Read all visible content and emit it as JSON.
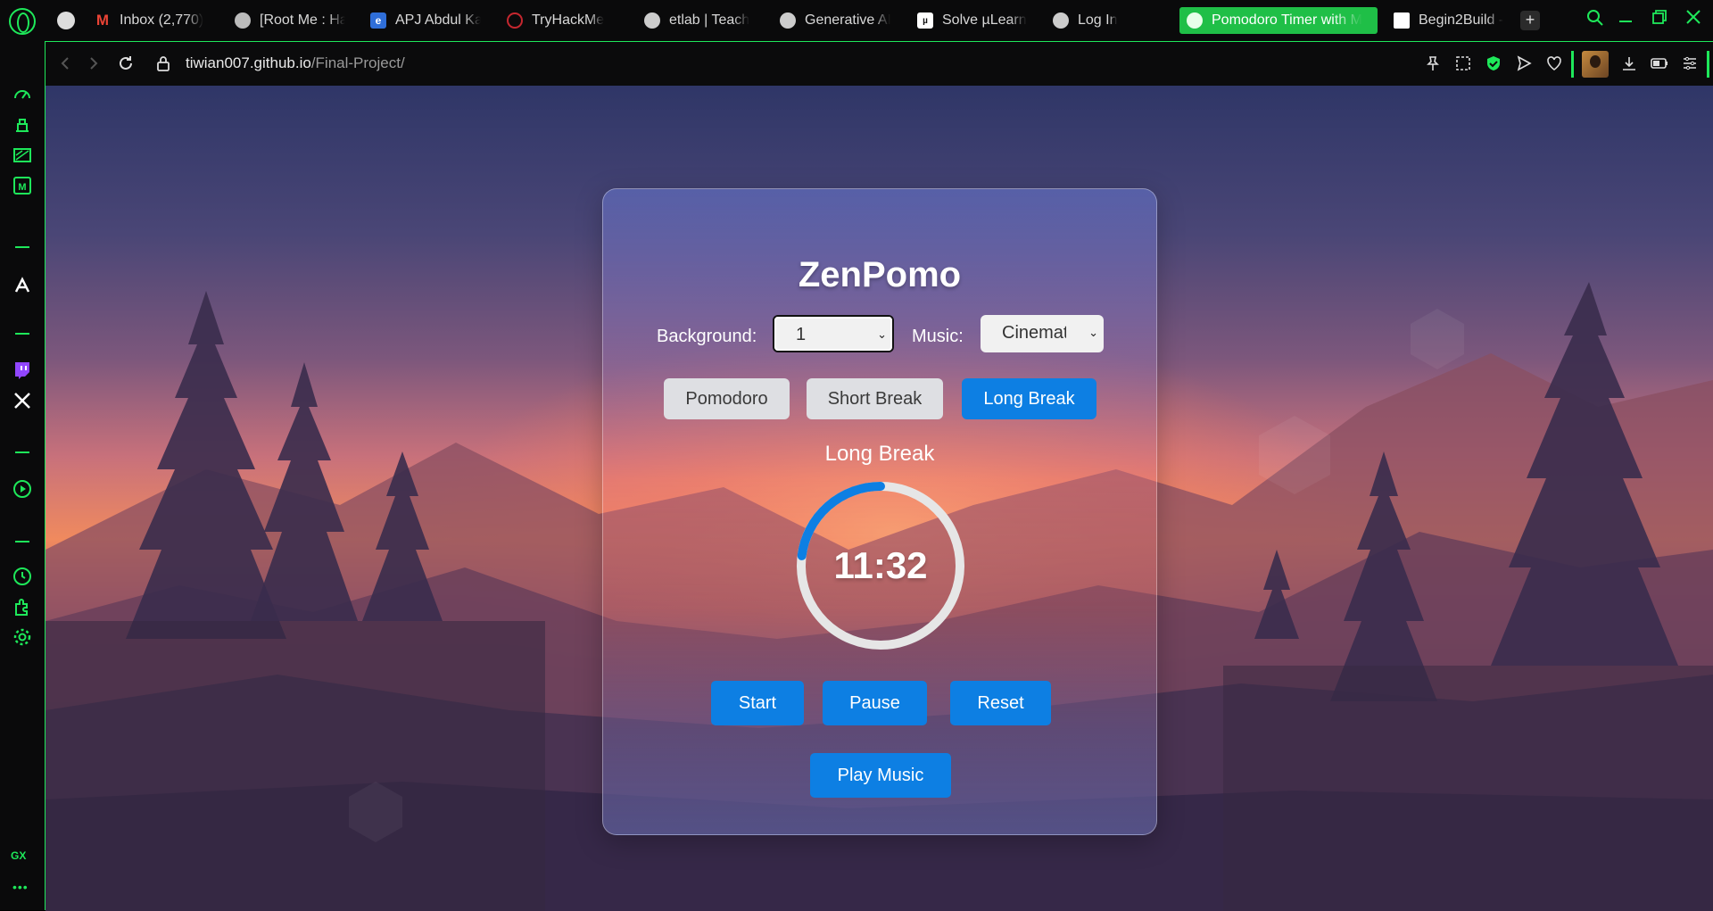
{
  "tabs": [
    {
      "label": "Inbox (2,770)",
      "icon": "gmail-icon"
    },
    {
      "label": "[Root Me : Ha",
      "icon": "rootme-icon"
    },
    {
      "label": "APJ Abdul Ka",
      "icon": "ktu-icon"
    },
    {
      "label": "TryHackMe",
      "icon": "tryhackme-icon"
    },
    {
      "label": "etlab | Teach",
      "icon": "globe-icon"
    },
    {
      "label": "Generative AI",
      "icon": "globe-icon"
    },
    {
      "label": "Solve µLearn",
      "icon": "mulearn-icon"
    },
    {
      "label": "Log In",
      "icon": "globe-icon"
    },
    {
      "label": "Pomodoro Timer with M",
      "icon": "globe-icon"
    },
    {
      "label": "Begin2Build -",
      "icon": "page-icon"
    }
  ],
  "address": {
    "host": "tiwian007.github.io",
    "path": "/Final-Project/"
  },
  "sidebar_badge": "GX",
  "app": {
    "title": "ZenPomo",
    "background_label": "Background:",
    "background_value": "1",
    "music_label": "Music:",
    "music_value": "Cinematic",
    "modes": {
      "pomodoro": "Pomodoro",
      "short": "Short Break",
      "long": "Long Break"
    },
    "current_mode": "Long Break",
    "timer": "11:32",
    "progress": 0.77,
    "buttons": {
      "start": "Start",
      "pause": "Pause",
      "reset": "Reset",
      "music": "Play Music"
    }
  },
  "colors": {
    "accent_green": "#1ee85a",
    "button_blue": "#0d7fe3",
    "ring_track": "#e6e6e6"
  }
}
